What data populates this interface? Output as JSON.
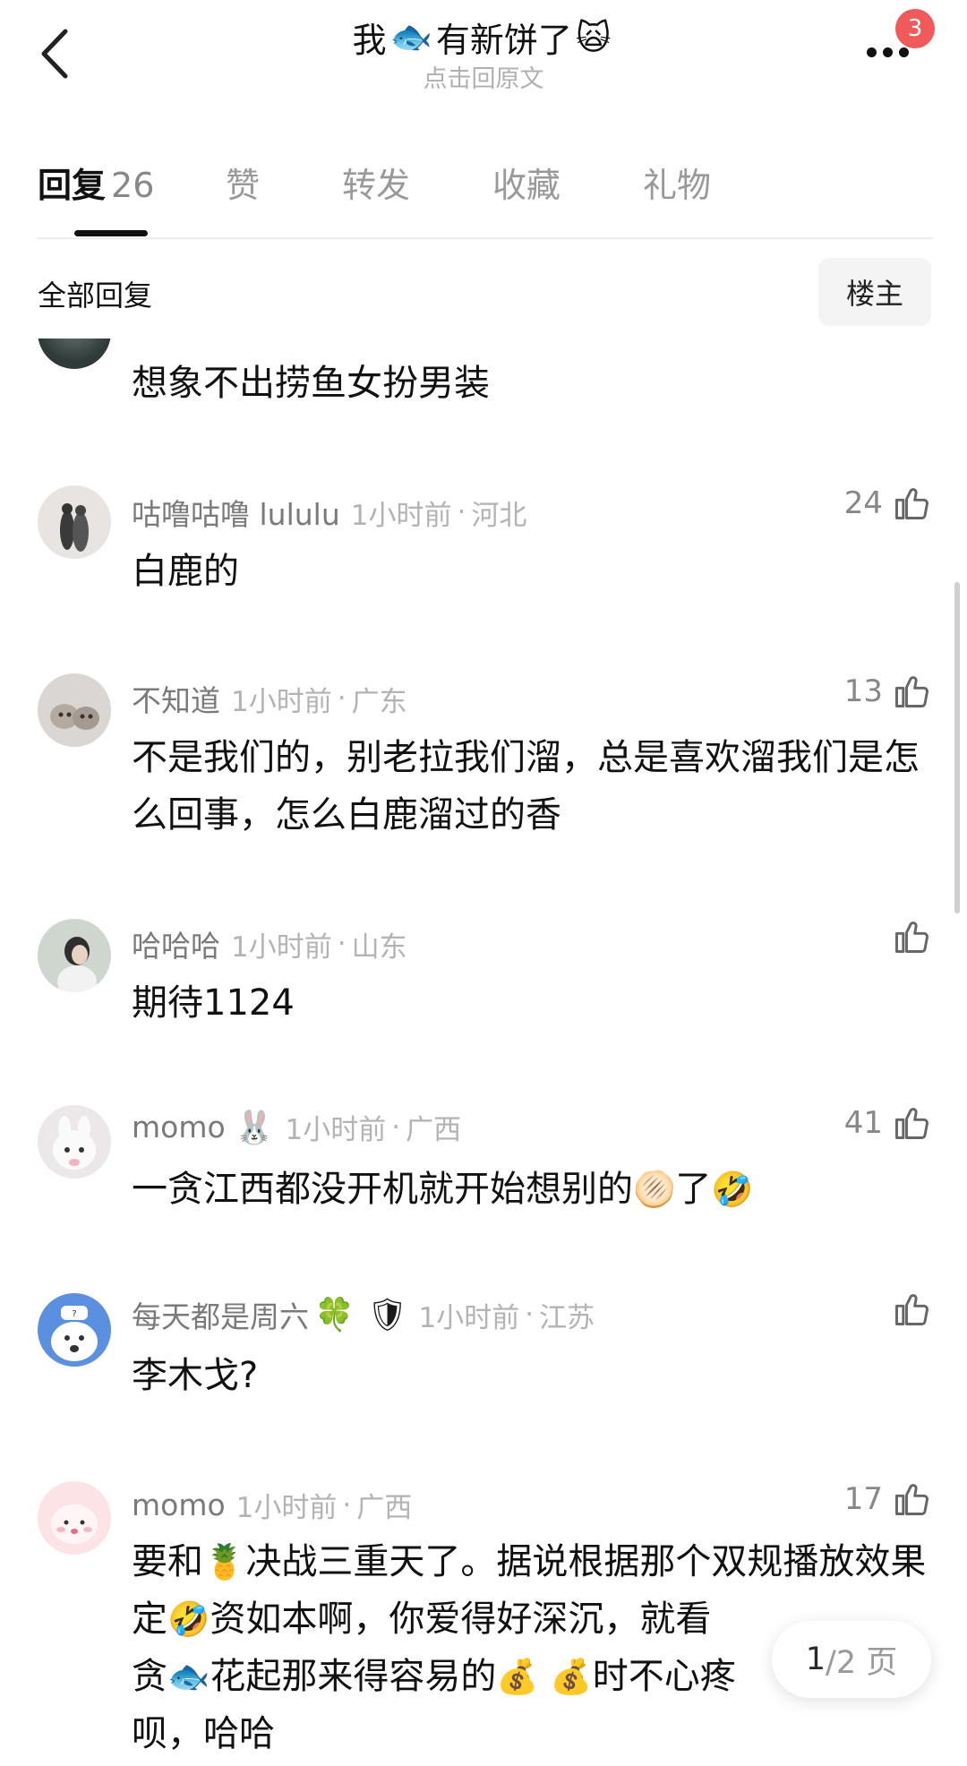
{
  "header": {
    "title_pre": "我",
    "title_emoji_fish": "🐟",
    "title_post": "有新饼了",
    "title_emoji_face": "🙀",
    "subtitle": "点击回原文",
    "notification_count": "3"
  },
  "tabs": [
    {
      "label": "回复",
      "count": "26"
    },
    {
      "label": "赞"
    },
    {
      "label": "转发"
    },
    {
      "label": "收藏"
    },
    {
      "label": "礼物"
    }
  ],
  "filter": {
    "label": "全部回复",
    "owner_button": "楼主"
  },
  "comments": [
    {
      "text": "想象不出捞鱼女扮男装"
    },
    {
      "name": "咕噜咕噜 lululu",
      "time": "1小时前",
      "region": "河北",
      "likes": "24",
      "text": "白鹿的"
    },
    {
      "name": "不知道",
      "time": "1小时前",
      "region": "广东",
      "likes": "13",
      "text": "不是我们的，别老拉我们溜，总是喜欢溜我们是怎么回事，怎么白鹿溜过的香"
    },
    {
      "name": "哈哈哈",
      "time": "1小时前",
      "region": "山东",
      "likes": "",
      "text": "期待1124"
    },
    {
      "name": "momo",
      "name_emoji": "🐰",
      "time": "1小时前",
      "region": "广西",
      "likes": "41",
      "text_pre": "一贪江西都没开机就开始想别的",
      "text_emoji1": "🫓",
      "text_mid": "了",
      "text_emoji2": "🤣"
    },
    {
      "name": "每天都是周六",
      "name_emoji": "🍀",
      "badge_emoji": "🛡",
      "time": "1小时前",
      "region": "江苏",
      "likes": "",
      "text": "李木戈?"
    },
    {
      "name": "momo",
      "time": "1小时前",
      "region": "广西",
      "likes": "17",
      "text_a": "要和",
      "emoji_pineapple": "🍍",
      "text_b": "决战三重天了。据说根据那个双规播放效果定",
      "emoji_rofl": "🤣",
      "text_c": "资如本啊，你爱得好深沉，就看",
      "text_d": "贪",
      "emoji_fish": "🐟",
      "text_e": "花起那来得容易的",
      "emoji_money": "💰",
      "text_f": "时不心疼",
      "text_g": "呗，哈哈"
    }
  ],
  "pager": {
    "current": "1",
    "total": "/2 页"
  }
}
